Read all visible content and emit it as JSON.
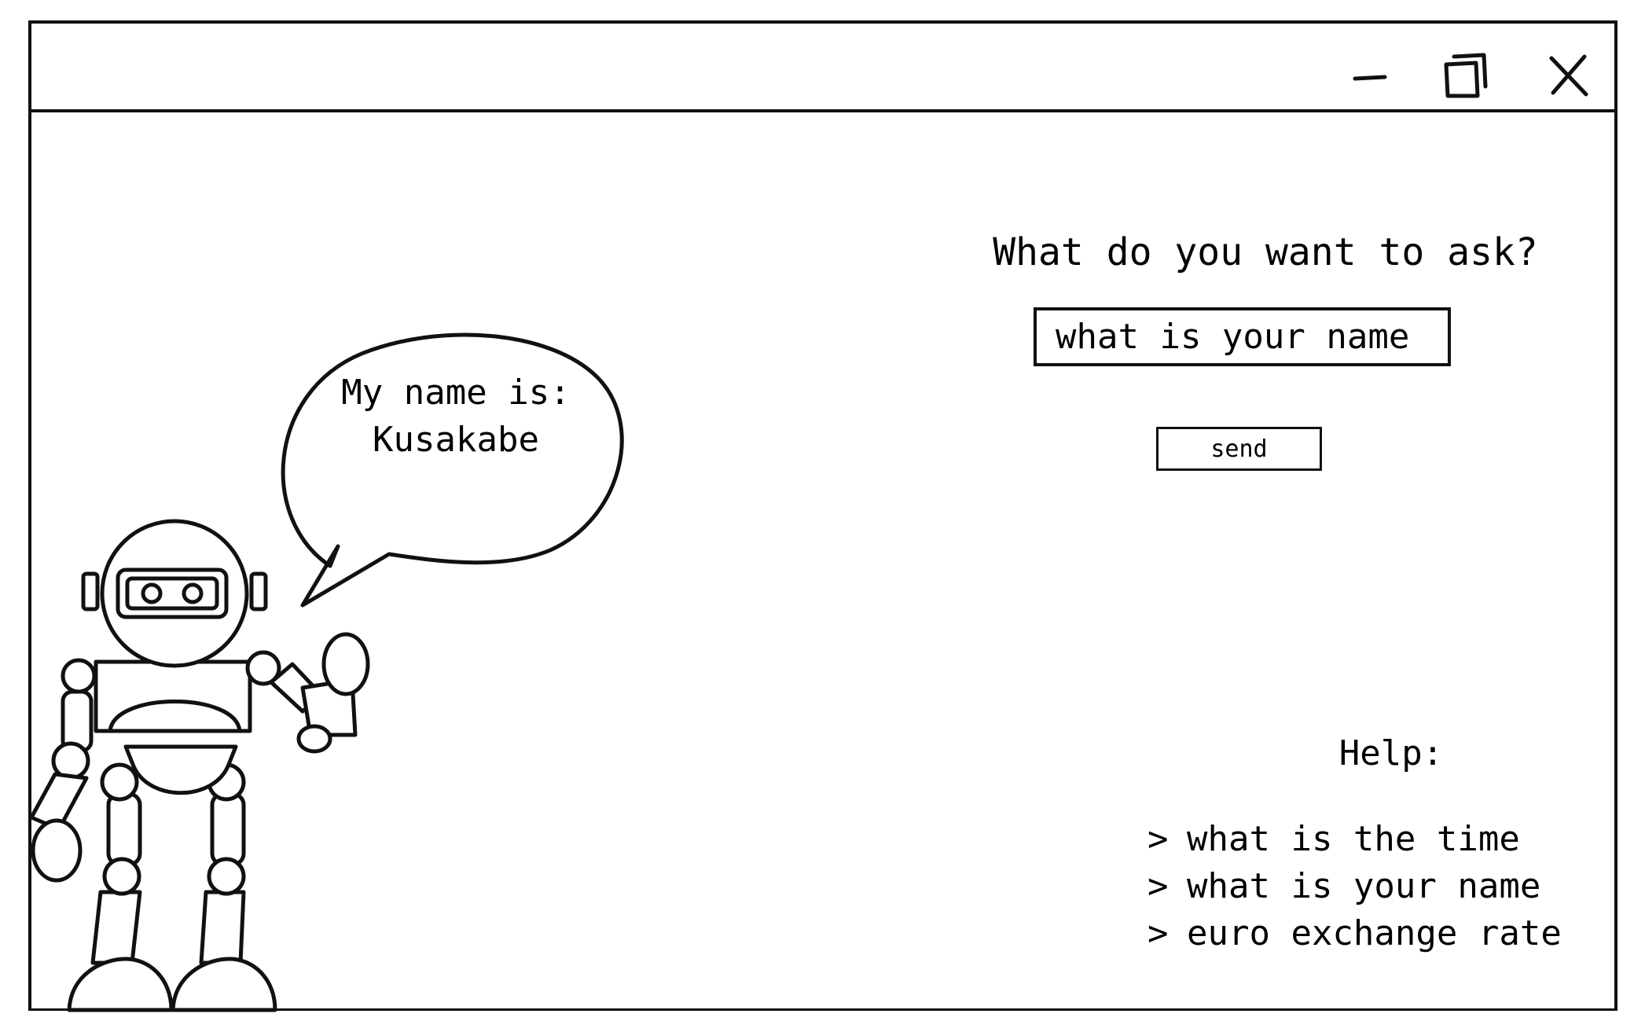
{
  "window": {
    "controls": {
      "minimize_icon": "minimize-icon",
      "maximize_icon": "maximize-icon",
      "close_icon": "close-icon"
    }
  },
  "main": {
    "question": "What do you want to ask?",
    "input_value": "what is your name",
    "send_label": "send"
  },
  "robot": {
    "speech_line1": "My name is:",
    "speech_line2": "Kusakabe"
  },
  "help": {
    "title": "Help:",
    "bullet": ">",
    "items": [
      "what is the time",
      "what is your name",
      "euro exchange rate"
    ]
  }
}
